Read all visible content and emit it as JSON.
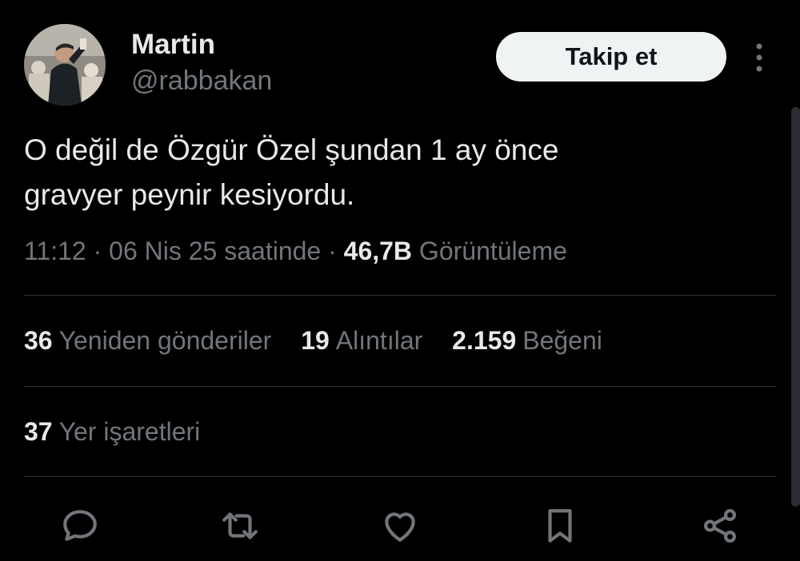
{
  "author": {
    "display_name": "Martin",
    "handle": "@rabbakan"
  },
  "follow_button_label": "Takip et",
  "tweet": {
    "text_lines": [
      "O değil de Özgür Özel şundan 1 ay önce",
      "gravyer peynir kesiyordu."
    ],
    "meta_prefix": "11:12 · 06 Nis 25 saatinde ·",
    "views_count": "46,7B",
    "views_label": "Görüntüleme"
  },
  "stats": {
    "reposts": {
      "count": "36",
      "label": "Yeniden gönderiler"
    },
    "quotes": {
      "count": "19",
      "label": "Alıntılar"
    },
    "likes": {
      "count": "2.159",
      "label": "Beğeni"
    },
    "bookmarks": {
      "count": "37",
      "label": "Yer işaretleri"
    }
  },
  "icons": {
    "reply": "reply-icon",
    "repost": "repost-icon",
    "like": "heart-icon",
    "bookmark": "bookmark-icon",
    "share": "share-icon",
    "more": "more-vertical-icon"
  },
  "colors": {
    "background": "#000000",
    "primary_text": "#e7e9ea",
    "secondary_text": "#71767b",
    "divider": "#2f3336",
    "button_bg": "#eff3f4"
  }
}
